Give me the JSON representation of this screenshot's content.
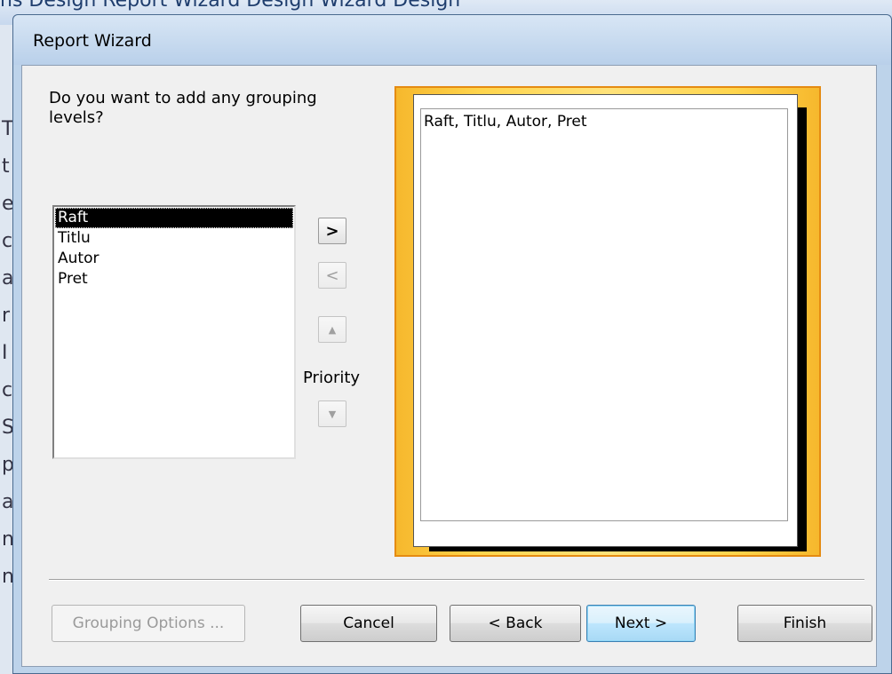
{
  "background": {
    "ribbon_text": "ns  Design        Report Wizard   Design    Wizard   Design",
    "left_letters": [
      "T",
      "t",
      "e",
      "c",
      "a",
      "r",
      "I",
      "c",
      "S",
      "p",
      "a",
      "n",
      "n"
    ]
  },
  "dialog": {
    "title": "Report Wizard",
    "question": "Do you want to add any grouping levels?",
    "fields": [
      "Raft",
      "Titlu",
      "Autor",
      "Pret"
    ],
    "selected_field": "Raft",
    "move_right_label": ">",
    "move_left_label": "<",
    "up_arrow_glyph": "▲",
    "down_arrow_glyph": "▼",
    "priority_label": "Priority",
    "preview_text": "Raft, Titlu, Autor, Pret",
    "buttons": {
      "grouping_options": "Grouping Options ...",
      "cancel": "Cancel",
      "back": "< Back",
      "next": "Next >",
      "finish": "Finish"
    },
    "accent_color": "#f6b82d"
  }
}
